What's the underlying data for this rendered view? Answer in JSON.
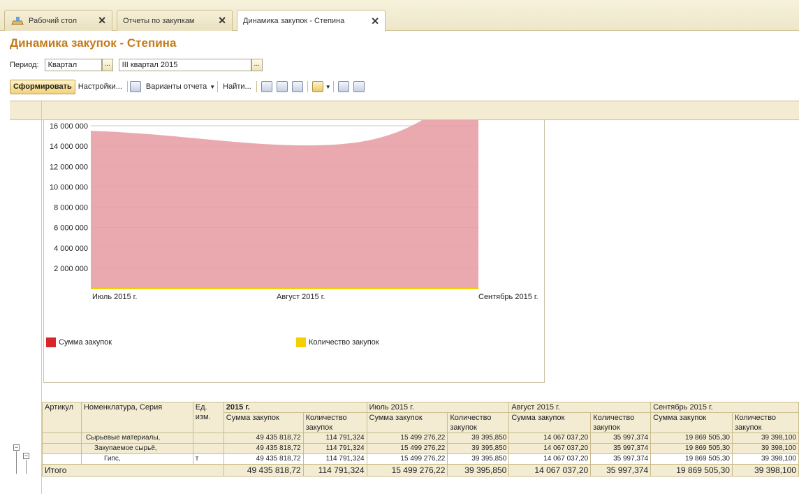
{
  "tabs": [
    {
      "label": "Рабочий стол"
    },
    {
      "label": "Отчеты по закупкам"
    },
    {
      "label": "Динамика закупок - Степина"
    }
  ],
  "title": "Динамика закупок - Степина",
  "period": {
    "label": "Период:",
    "type": "Квартал",
    "value": "III квартал 2015"
  },
  "toolbar": {
    "generate": "Сформировать",
    "settings": "Настройки...",
    "variants": "Варианты отчета",
    "find": "Найти..."
  },
  "chart_data": {
    "type": "area",
    "x": [
      "Июль 2015 г.",
      "Август 2015 г.",
      "Сентябрь 2015 г."
    ],
    "series": [
      {
        "name": "Сумма закупок",
        "values": [
          15499276.22,
          14067037.2,
          19869505.3
        ],
        "color": "#e8a0a6"
      },
      {
        "name": "Количество закупок",
        "values": [
          39395.85,
          35997.374,
          39398.1
        ],
        "color": "#f5d000"
      }
    ],
    "yticks": [
      "16 000 000",
      "14 000 000",
      "12 000 000",
      "10 000 000",
      "8 000 000",
      "6 000 000",
      "4 000 000",
      "2 000 000"
    ],
    "ylim": [
      0,
      16000000
    ],
    "grid": true,
    "legend": "bottom"
  },
  "legend_colors": {
    "sum": "#d9262a",
    "qty": "#f5d000"
  },
  "table": {
    "h_article": "Артикул",
    "h_nom": "Номенклатура, Серия",
    "h_unit": "Ед. изм.",
    "periods": [
      "2015 г.",
      "Июль 2015 г.",
      "Август 2015 г.",
      "Сентябрь 2015 г."
    ],
    "h_sum": "Сумма закупок",
    "h_qty": "Количество закупок",
    "rows": [
      {
        "name": "Сырьевые материалы,",
        "unit": "",
        "v": [
          "49 435 818,72",
          "114 791,324",
          "15 499 276,22",
          "39 395,850",
          "14 067 037,20",
          "35 997,374",
          "19 869 505,30",
          "39 398,100"
        ]
      },
      {
        "name": "Закупаемое сырьё,",
        "unit": "",
        "v": [
          "49 435 818,72",
          "114 791,324",
          "15 499 276,22",
          "39 395,850",
          "14 067 037,20",
          "35 997,374",
          "19 869 505,30",
          "39 398,100"
        ]
      },
      {
        "name": "Гипс,",
        "unit": "т",
        "v": [
          "49 435 818,72",
          "114 791,324",
          "15 499 276,22",
          "39 395,850",
          "14 067 037,20",
          "35 997,374",
          "19 869 505,30",
          "39 398,100"
        ]
      }
    ],
    "total_label": "Итого",
    "total": [
      "49 435 818,72",
      "114 791,324",
      "15 499 276,22",
      "39 395,850",
      "14 067 037,20",
      "35 997,374",
      "19 869 505,30",
      "39 398,100"
    ]
  }
}
